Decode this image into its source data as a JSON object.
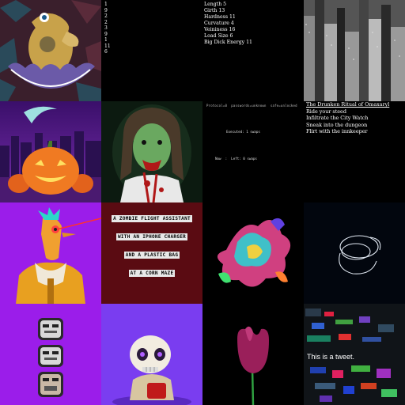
{
  "gallery": {
    "tiles": [
      {
        "name": "platypus-egg-tile"
      },
      {
        "name": "numbers-list-tile",
        "lines": [
          "1",
          "9",
          "2",
          "2",
          "3",
          "9",
          "1",
          "11",
          "6"
        ]
      },
      {
        "name": "stats-list-tile",
        "lines": [
          "Length 5",
          "Girth 13",
          "Hardness 11",
          "Curvature 4",
          "Veininess 16",
          "Load Size 6",
          "Big Dick Energy 11"
        ]
      },
      {
        "name": "city-skyscrapers-tile"
      },
      {
        "name": "halloween-pumpkin-tile"
      },
      {
        "name": "zombie-portrait-tile"
      },
      {
        "name": "terminal-text-tile",
        "header": "Protocol=0  passwords=unknown  safe=unlocked",
        "line1": "Executed: 1 swaps",
        "line2": "Now  :  Left: 0 swaps"
      },
      {
        "name": "quest-list-tile",
        "title": "The Drunken Ritual of Omaxaryl",
        "items": [
          "Ride your steed",
          "Infiltrate the City Watch",
          "Sneak into the dungeon",
          "Flirt with the innkeeper"
        ]
      },
      {
        "name": "seahorse-jacket-tile"
      },
      {
        "name": "flight-assistant-text-tile",
        "lines": [
          "A ZOMBIE FLIGHT ASSISTANT",
          "WITH AN IPHONE CHARGER",
          "AND A PLASTIC BAG",
          "AT A CORN MAZE"
        ]
      },
      {
        "name": "abstract-sculpture-tile"
      },
      {
        "name": "wire-loops-tile"
      },
      {
        "name": "stacked-robots-tile"
      },
      {
        "name": "skull-character-tile"
      },
      {
        "name": "tulip-flower-tile"
      },
      {
        "name": "glitch-tweet-tile",
        "tweet_text": "This is a tweet."
      }
    ]
  },
  "colors": {
    "purple_bg": "#9b1dea",
    "violet_bg": "#7a3df0",
    "maroon_bg": "#5a0b12",
    "black": "#000000"
  }
}
